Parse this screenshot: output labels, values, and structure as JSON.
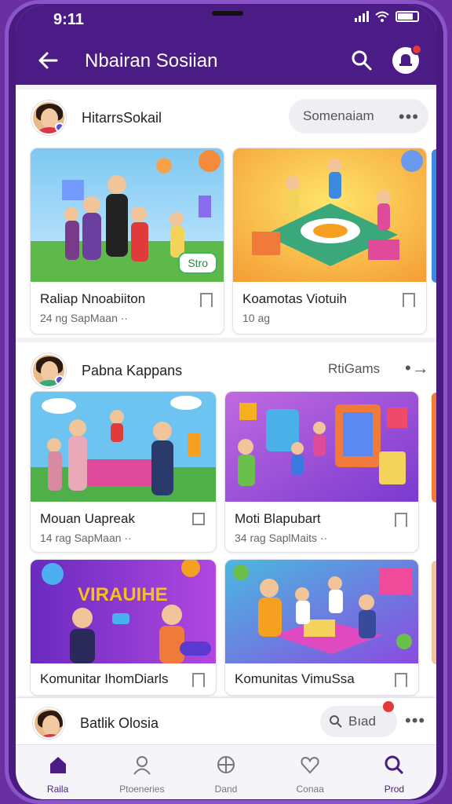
{
  "status": {
    "time": "9:11"
  },
  "app": {
    "title": "Nbairan Sosiian"
  },
  "sections": [
    {
      "title": "HitarrsSokail",
      "pill": "Somenaiam",
      "more": "•••",
      "cards": [
        {
          "title": "Raliap Nnoabiiton",
          "meta": "24 ng  SapMaan ·· ",
          "tag": "Stro"
        },
        {
          "title": "Koamotas Viotuih",
          "meta": "10 ag"
        }
      ]
    },
    {
      "title": "Pabna Kappans",
      "pill": "RtiGams",
      "more": "•→",
      "cards": [
        {
          "title": "Mouan Uapreak",
          "meta": "14 rag  SapMaan ·· "
        },
        {
          "title": "Moti Blapubart",
          "meta": "34 rag  SaplMaits ·· "
        },
        {
          "title": "Komunitar IhomDiarls",
          "meta": "",
          "banner": "VIRAUIHE"
        },
        {
          "title": "Komunitas VimuSsa",
          "meta": ""
        }
      ]
    }
  ],
  "bottom_post": {
    "title": "Batlik Olosia",
    "pill": "Bıad",
    "more": "•••"
  },
  "tabs": [
    {
      "label": "Raila",
      "icon": "home-icon",
      "active": true
    },
    {
      "label": "Ptoeneries",
      "icon": "person-icon",
      "active": false
    },
    {
      "label": "Dand",
      "icon": "globe-icon",
      "active": false
    },
    {
      "label": "Conaa",
      "icon": "heart-icon",
      "active": false
    },
    {
      "label": "Prod",
      "icon": "search-icon",
      "active": true
    }
  ],
  "colors": {
    "primary": "#4b1c86",
    "accent": "#e23a3a",
    "tag_green": "#41b55a"
  }
}
